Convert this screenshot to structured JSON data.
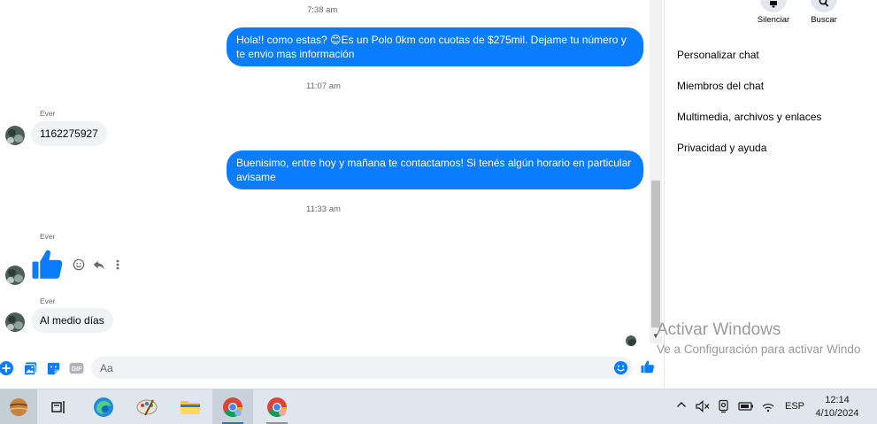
{
  "chat": {
    "messages": [
      {
        "type": "timestamp",
        "text": "7:38 am"
      },
      {
        "type": "outgoing",
        "text": "Hola!! como estas? 😊Es un Polo 0km con cuotas de $275mil. Dejame tu número y te envio mas información"
      },
      {
        "type": "timestamp",
        "text": "11:07 am"
      },
      {
        "type": "incoming",
        "sender": "Ever",
        "text": "1162275927"
      },
      {
        "type": "outgoing",
        "text": "Buenisimo, entre hoy y mañana te contactamos! Si tenés algún horario en particular avisame"
      },
      {
        "type": "timestamp",
        "text": "11:33 am"
      },
      {
        "type": "incoming_like",
        "sender": "Ever"
      },
      {
        "type": "incoming",
        "sender": "Ever",
        "text": "Al medio días"
      }
    ]
  },
  "composer": {
    "placeholder": "Aa"
  },
  "info_panel": {
    "top_actions": [
      {
        "label": "Silenciar",
        "icon": "bell-icon"
      },
      {
        "label": "Buscar",
        "icon": "search-icon"
      }
    ],
    "menu": [
      {
        "label": "Personalizar chat"
      },
      {
        "label": "Miembros del chat"
      },
      {
        "label": "Multimedia, archivos y enlaces"
      },
      {
        "label": "Privacidad y ayuda"
      }
    ]
  },
  "watermark": {
    "line1": "Activar Windows",
    "line2": "Ve a Configuración para activar Windo"
  },
  "taskbar": {
    "tray": {
      "language": "ESP"
    },
    "clock": {
      "time": "12:14",
      "date": "4/10/2024"
    }
  },
  "colors": {
    "messenger_blue": "#0a7cff",
    "bubble_gray": "#f0f2f5",
    "taskbar": "#dfe6ee"
  }
}
